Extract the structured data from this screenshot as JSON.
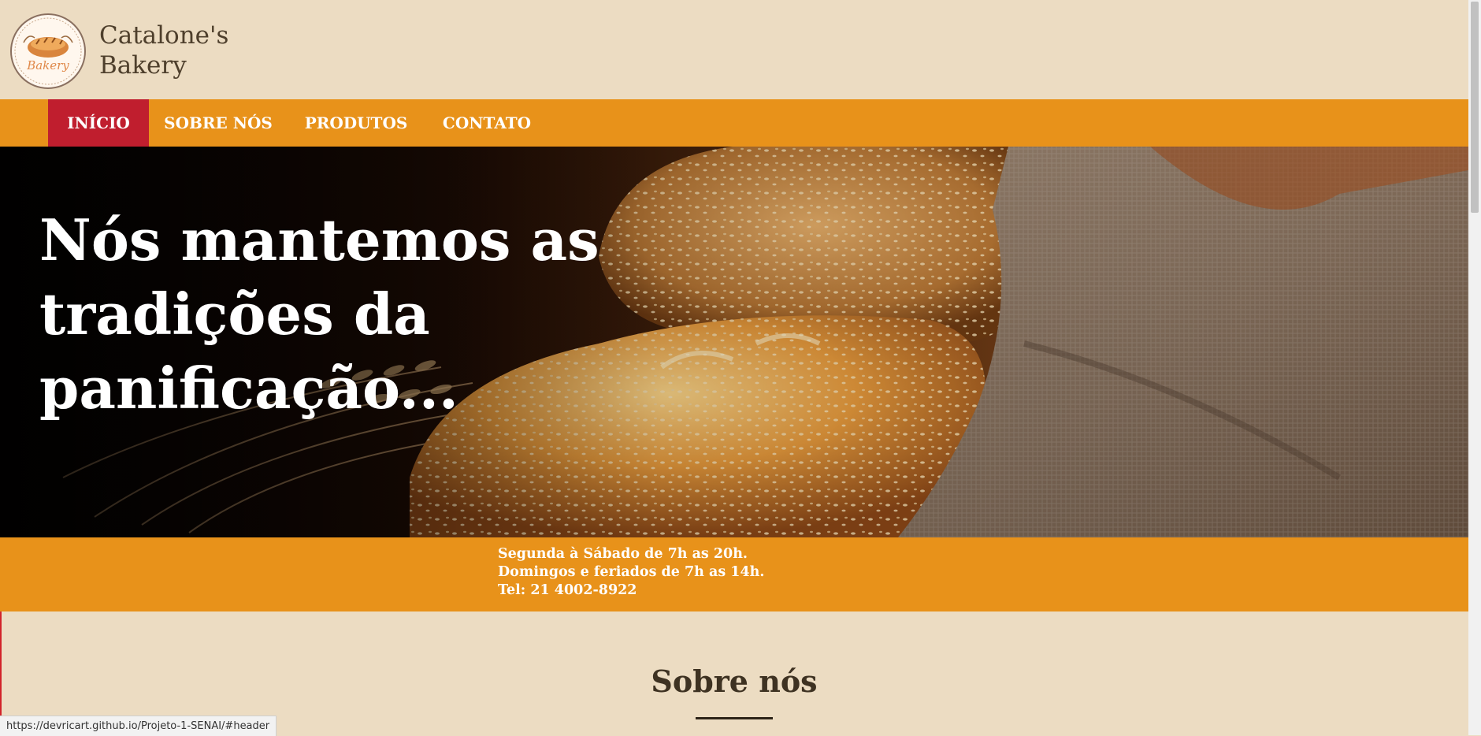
{
  "brand": {
    "name_line1": "Catalone's",
    "name_line2": "Bakery",
    "logo_text": "Bakery"
  },
  "nav": {
    "items": [
      {
        "label": "INÍCIO",
        "active": true
      },
      {
        "label": "SOBRE NÓS",
        "active": false
      },
      {
        "label": "PRODUTOS",
        "active": false
      },
      {
        "label": "CONTATO",
        "active": false
      }
    ]
  },
  "hero": {
    "title_line1": "Nós mantemos as",
    "title_line2": "tradições da panificação..."
  },
  "info": {
    "hours_weekdays": "Segunda à Sábado de 7h as 20h.",
    "hours_weekends": "Domingos e feriados de 7h as 14h.",
    "phone": "Tel: 21 4002-8922"
  },
  "about": {
    "title": "Sobre nós"
  },
  "status": {
    "url": "https://devricart.github.io/Projeto-1-SENAI/#header"
  },
  "colors": {
    "accent": "#e8921a",
    "active_nav": "#c01e2e",
    "background": "#ecdcc2"
  }
}
